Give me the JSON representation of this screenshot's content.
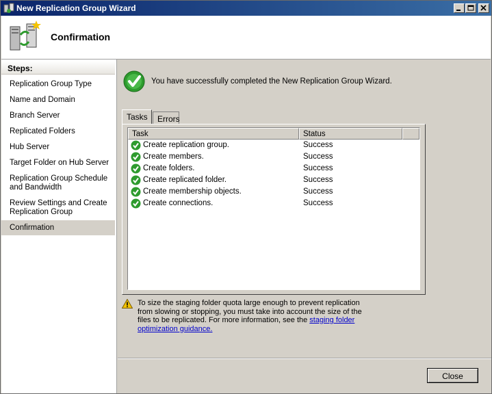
{
  "window": {
    "title": "New Replication Group Wizard"
  },
  "titlebar_buttons": {
    "minimize": "minimize-icon",
    "maximize": "maximize-icon",
    "close": "close-icon"
  },
  "header": {
    "title": "Confirmation",
    "icon": "replication-servers-icon"
  },
  "sidebar": {
    "heading": "Steps:",
    "items": [
      {
        "label": "Replication Group Type"
      },
      {
        "label": "Name and Domain"
      },
      {
        "label": "Branch Server"
      },
      {
        "label": "Replicated Folders"
      },
      {
        "label": "Hub Server"
      },
      {
        "label": "Target Folder on Hub Server"
      },
      {
        "label": "Replication Group Schedule and Bandwidth"
      },
      {
        "label": "Review Settings and Create Replication Group"
      },
      {
        "label": "Confirmation",
        "active": true
      }
    ]
  },
  "main": {
    "success_message": "You have successfully completed the New Replication Group Wizard.",
    "tabs": [
      {
        "label": "Tasks",
        "active": true
      },
      {
        "label": "Errors"
      }
    ],
    "columns": {
      "task": "Task",
      "status": "Status"
    },
    "rows": [
      {
        "task": "Create replication group.",
        "status": "Success"
      },
      {
        "task": "Create members.",
        "status": "Success"
      },
      {
        "task": "Create folders.",
        "status": "Success"
      },
      {
        "task": "Create replicated folder.",
        "status": "Success"
      },
      {
        "task": "Create membership objects.",
        "status": "Success"
      },
      {
        "task": "Create connections.",
        "status": "Success"
      }
    ],
    "warning_text": "To size the staging folder quota large enough to prevent replication from slowing or stopping, you must take into account the size of the files to be replicated. For more information, see the ",
    "warning_link": "staging folder optimization guidance.",
    "close_button": "Close"
  },
  "colors": {
    "titlebar": "#0a246a",
    "success": "#2e9b2e",
    "link": "#0000cc",
    "warning": "#f2c200"
  }
}
